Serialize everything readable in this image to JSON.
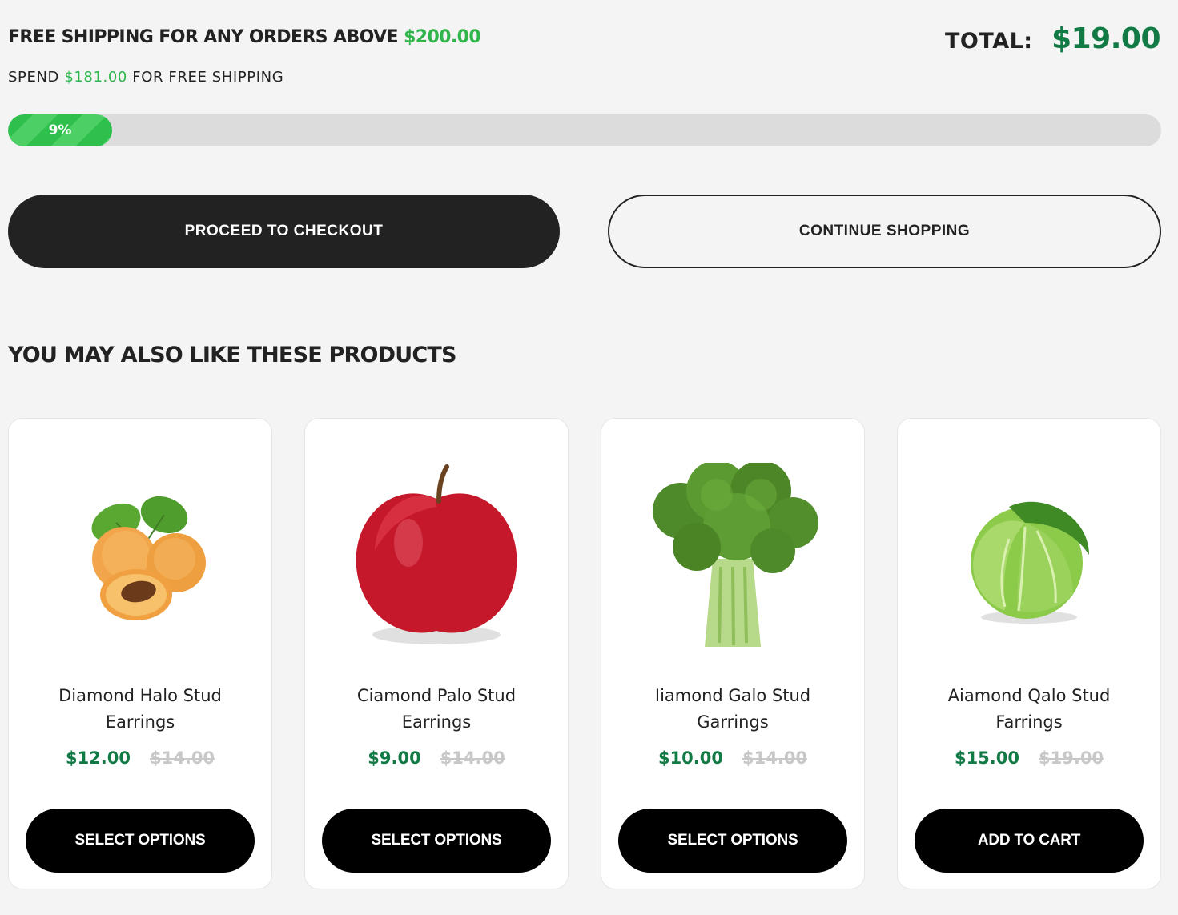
{
  "shipping": {
    "title_prefix": "FREE SHIPPING FOR ANY ORDERS ABOVE",
    "threshold": "$200.00",
    "spend_prefix": "SPEND",
    "spend_amount": "$181.00",
    "spend_suffix": "FOR FREE SHIPPING",
    "progress_label": "9%",
    "progress_fraction": 0.09
  },
  "totals": {
    "label": "TOTAL:",
    "value": "$19.00"
  },
  "actions": {
    "checkout": "PROCEED TO CHECKOUT",
    "continue": "CONTINUE SHOPPING"
  },
  "related": {
    "title": "YOU MAY ALSO LIKE THESE PRODUCTS",
    "products": [
      {
        "line1": "Diamond Halo Stud",
        "line2": "Earrings",
        "price": "$12.00",
        "old_price": "$14.00",
        "button": "SELECT OPTIONS",
        "image": "apricot-image"
      },
      {
        "line1": "Ciamond Palo Stud",
        "line2": "Earrings",
        "price": "$9.00",
        "old_price": "$14.00",
        "button": "SELECT OPTIONS",
        "image": "apple-image"
      },
      {
        "line1": "Iiamond Galo Stud",
        "line2": "Garrings",
        "price": "$10.00",
        "old_price": "$14.00",
        "button": "SELECT OPTIONS",
        "image": "broccoli-image"
      },
      {
        "line1": "Aiamond Qalo Stud",
        "line2": "Farrings",
        "price": "$15.00",
        "old_price": "$19.00",
        "button": "ADD TO CART",
        "image": "cabbage-image"
      }
    ]
  },
  "colors": {
    "accent_green": "#2fb54a",
    "price_green": "#127a45",
    "dark": "#222222"
  }
}
